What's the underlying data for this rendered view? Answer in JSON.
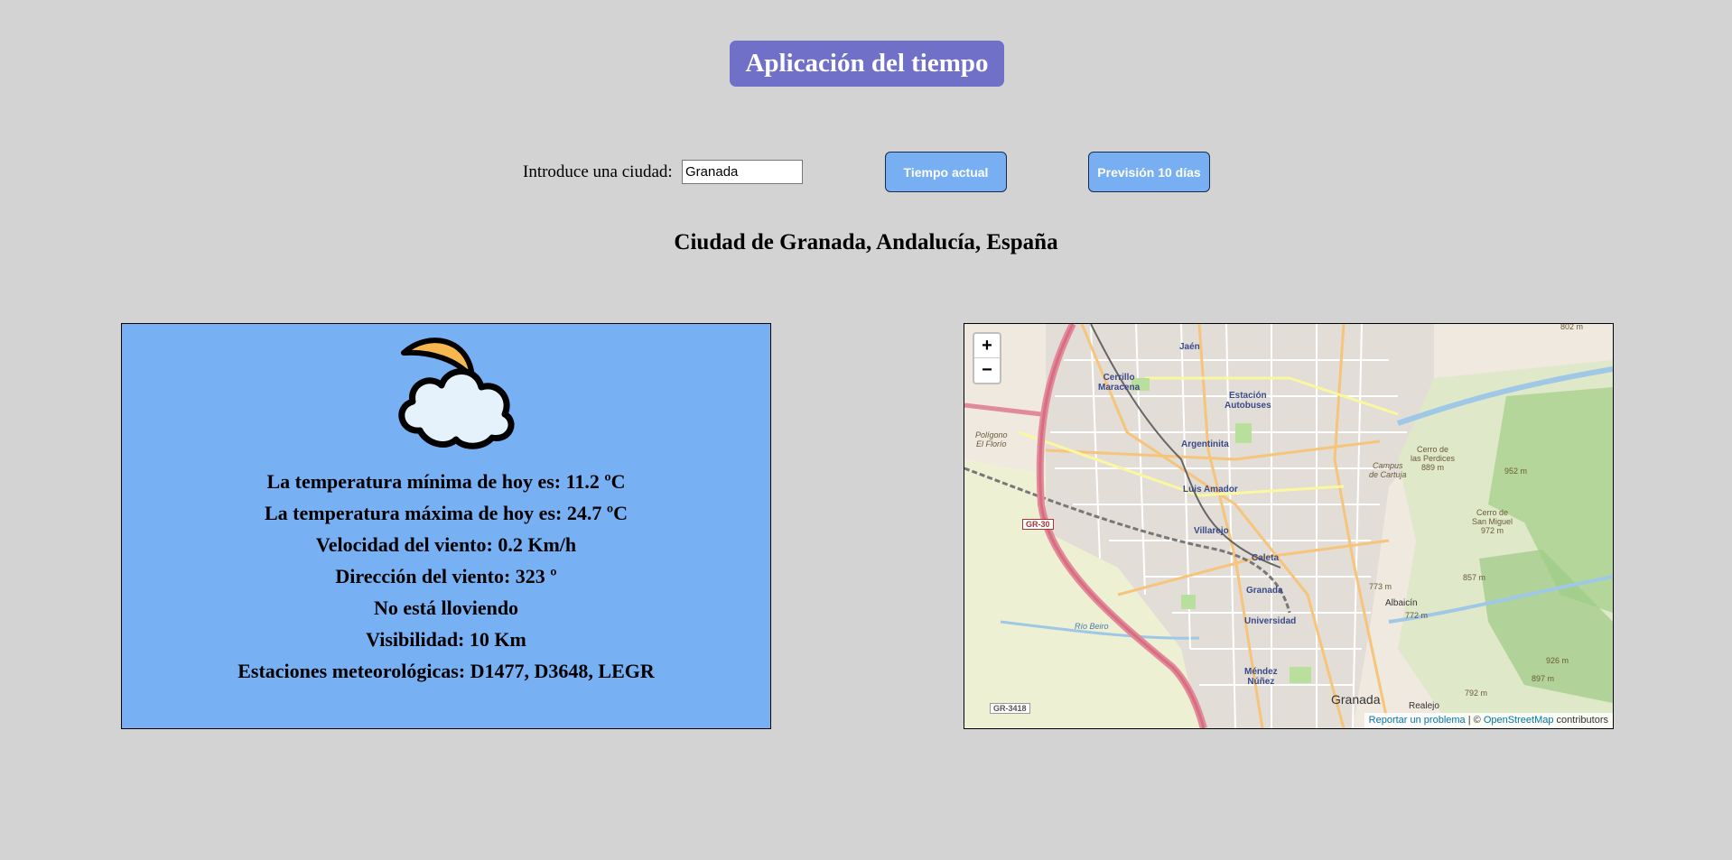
{
  "header": {
    "title": "Aplicación del tiempo"
  },
  "search": {
    "label": "Introduce una ciudad:",
    "value": "Granada",
    "current_button": "Tiempo actual",
    "forecast_button": "Previsión 10 días"
  },
  "location": {
    "heading": "Ciudad de Granada, Andalucía, España"
  },
  "weather": {
    "icon": "moon-cloud-icon",
    "lines": [
      "La temperatura mínima de hoy es: 11.2 ºC",
      "La temperatura máxima de hoy es: 24.7 ºC",
      "Velocidad del viento: 0.2 Km/h",
      "Dirección del viento: 323 º",
      "No está lloviendo",
      "Visibilidad: 10 Km",
      "Estaciones meteorológicas: D1477, D3648, LEGR"
    ]
  },
  "map": {
    "zoom_in": "+",
    "zoom_out": "−",
    "attribution": {
      "report": "Reportar un problema",
      "separator": " | © ",
      "osm": "OpenStreetMap",
      "contributors": " contributors"
    },
    "labels": {
      "jaen": "Jaén",
      "cerrillo": "Cerrillo\nMaracena",
      "estacion": "Estación\nAutobuses",
      "argentinita": "Argentinita",
      "luis_amador": "Luis Amador",
      "villarejo": "Villarejo",
      "caleta": "Caleta",
      "granada_small": "Granada",
      "universidad": "Universidad",
      "mendez": "Méndez\nNúñez",
      "granada": "Granada",
      "albaicin": "Albaicín",
      "realejo": "Realejo",
      "poligono": "Polígono\nEl Florío",
      "campus": "Campus\nde Cartuja",
      "cerro_perdices": "Cerro de\nlas Perdices\n889 m",
      "cerro_miguel": "Cerro de\nSan Miguel\n972 m",
      "gr30": "GR-30",
      "gr3418": "GR-3418",
      "rio_beiro": "Río Beiro",
      "m952": "952 m",
      "m857": "857 m",
      "m773": "773 m",
      "m772": "772 m",
      "m792": "792 m",
      "m926": "926 m",
      "m897": "897 m",
      "m802": "802 m"
    }
  },
  "colors": {
    "background": "#d3d3d3",
    "title_bg": "#7070c8",
    "button_bg": "#77aff2",
    "weather_panel_bg": "#78b0f4",
    "moon": "#f6b84e",
    "cloud": "#e6f2fb"
  }
}
